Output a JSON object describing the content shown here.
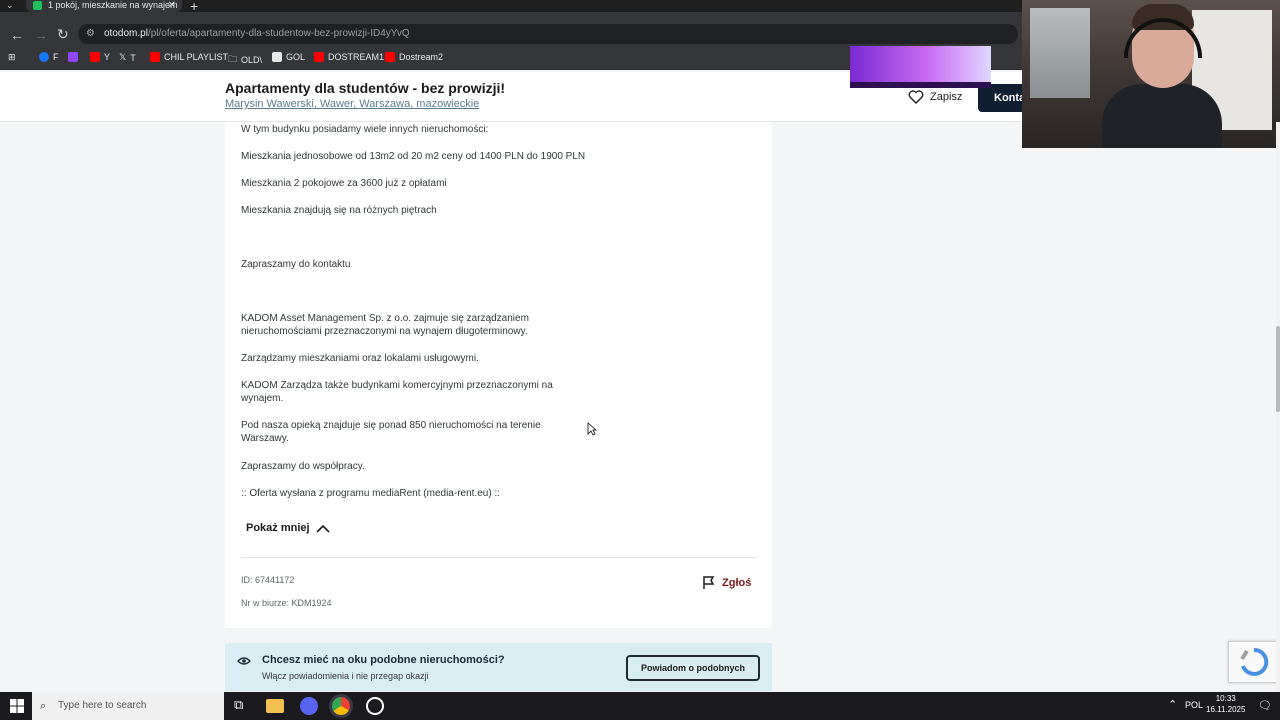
{
  "browser": {
    "tab_title": "1 pokój, mieszkanie na wynajem",
    "url_host": "otodom.pl",
    "url_path": "/pl/oferta/apartamenty-dla-studentow-bez-prowizji-ID4yYvQ",
    "bookmarks": [
      {
        "label": "F",
        "color": "#1877f2"
      },
      {
        "label": "",
        "color": "#9146ff"
      },
      {
        "label": "Y",
        "color": "#ff0000"
      },
      {
        "label": "T",
        "color": "#ffffff"
      },
      {
        "label": "CHIL PLAYLIST",
        "color": "#ff0000"
      },
      {
        "label": "OLD\\",
        "color": "#cccccc"
      },
      {
        "label": "GOL",
        "color": "#e8e8e8"
      },
      {
        "label": "DOSTREAM1",
        "color": "#ff0000"
      },
      {
        "label": "Dostream2",
        "color": "#ff0000"
      }
    ]
  },
  "header": {
    "title": "Apartamenty dla studentów - bez prowizji!",
    "location": "Marysin Wawerski, Wawer, Warszawa, mazowieckie",
    "save_label": "Zapisz",
    "contact_label": "Konta"
  },
  "description": {
    "lines": [
      "W tym budynku posiadamy wiele innych nieruchomości:",
      "Mieszkania jednosobowe od 13m2 od 20 m2 ceny od 1400 PLN do 1900 PLN",
      "Mieszkania 2 pokojowe za 3600 już z opłatami",
      "Mieszkania znajdują się na różnych piętrach",
      "Zapraszamy do kontaktu",
      "KADOM Asset Management Sp. z o.o. zajmuje się zarządzaniem nieruchomościami przeznaczonymi na wynajem długoterminowy.",
      "Zarządzamy mieszkaniami oraz lokalami usługowymi.",
      "KADOM Zarządza także budynkami komercyjnymi przeznaczonymi na wynajem.",
      "Pod nasza opieką znajduje się ponad 850 nieruchomości na terenie Warszawy.",
      "Zapraszamy do współpracy.",
      ":: Oferta wysłana z programu mediaRent (media-rent.eu) ::"
    ],
    "show_less_label": "Pokaż mniej"
  },
  "meta": {
    "id": "ID: 67441172",
    "office_no": "Nr w biurze: KDM1924",
    "report_label": "Zgłoś"
  },
  "alert": {
    "title": "Chcesz mieć na oku podobne nieruchomości?",
    "subtitle": "Włącz powiadomienia i nie przegap okazji",
    "button_label": "Powiadom o podobnych"
  },
  "taskbar": {
    "search_placeholder": "Type here to search",
    "language": "POL",
    "time": "10:33",
    "date": "16.11.2025"
  },
  "colors": {
    "accent_dark": "#0f1e33",
    "alert_bg": "#d9eef3",
    "report_red": "#7a1a1a"
  }
}
